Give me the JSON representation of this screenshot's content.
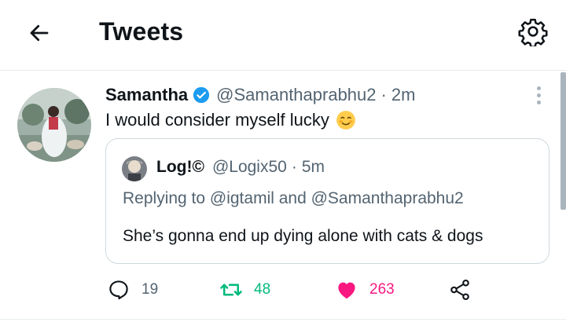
{
  "header": {
    "title": "Tweets"
  },
  "tweet": {
    "author_name": "Samantha",
    "handle": "@Samanthaprabhu2",
    "separator": "·",
    "time": "2m",
    "text": "I would consider myself lucky",
    "emoji": "☺️"
  },
  "quote": {
    "author_name": "Log!©",
    "handle": "@Logix50",
    "separator": "·",
    "time": "5m",
    "reply_line": "Replying to @igtamil and @Samanthaprabhu2",
    "text": "She’s gonna end up dying alone with cats & dogs"
  },
  "actions": {
    "replies": "19",
    "retweets": "48",
    "likes": "263"
  },
  "icons": {
    "back": "arrow-left-icon",
    "settings": "gear-icon",
    "verified": "verified-badge-icon",
    "more": "more-vertical-icon",
    "reply": "reply-icon",
    "retweet": "retweet-icon",
    "like": "heart-icon",
    "share": "share-icon"
  },
  "colors": {
    "verified": "#1d9bf0",
    "retweet": "#00ba7c",
    "like": "#f91880",
    "muted": "#536471"
  }
}
